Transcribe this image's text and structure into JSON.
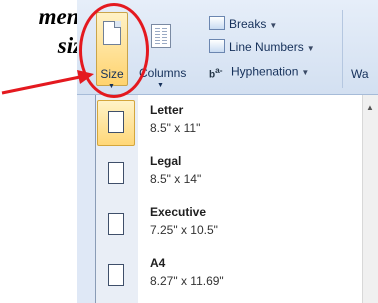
{
  "annotation": {
    "line1": "menu,",
    "line2": "size."
  },
  "ribbon": {
    "size_button": {
      "label": "Size",
      "icon": "page-size-icon"
    },
    "columns_button": {
      "label": "Columns",
      "icon": "columns-icon"
    },
    "breaks": {
      "label": "Breaks",
      "icon": "breaks-icon"
    },
    "line_numbers": {
      "label": "Line Numbers",
      "icon": "line-numbers-icon"
    },
    "hyphenation": {
      "label": "Hyphenation",
      "icon": "hyphenation-icon"
    },
    "partial_left": "n",
    "partial_right": "Wa"
  },
  "size_menu": {
    "items": [
      {
        "name": "Letter",
        "dims": "8.5\" x 11\"",
        "selected": true
      },
      {
        "name": "Legal",
        "dims": "8.5\" x 14\"",
        "selected": false
      },
      {
        "name": "Executive",
        "dims": "7.25\" x 10.5\"",
        "selected": false
      },
      {
        "name": "A4",
        "dims": "8.27\" x 11.69\"",
        "selected": false
      }
    ]
  },
  "colors": {
    "highlight_circle": "#e4191f",
    "arrow": "#e4191f",
    "selected_item": "#ffd778"
  }
}
